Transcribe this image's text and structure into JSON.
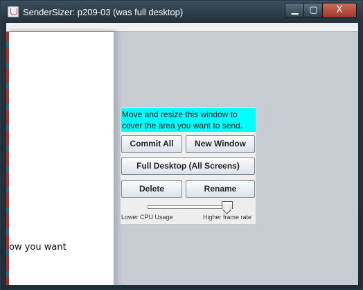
{
  "window": {
    "title": "SenderSizer: p209-03 (was full desktop)",
    "controls": {
      "minimize": "▁",
      "maximize": "▢",
      "close": "X"
    }
  },
  "desktop": {
    "partial_text": "ow you want"
  },
  "panel": {
    "info_text": "Move and resize this window to cover the area you want to send.",
    "info_color": "#00ffff",
    "buttons": {
      "commit_all": "Commit All",
      "new_window": "New Window",
      "full_desktop": "Full Desktop (All Screens)",
      "delete": "Delete",
      "rename": "Rename"
    },
    "slider": {
      "low_label": "Lower CPU Usage",
      "high_label": "Higher frame rate",
      "value_fraction": 0.95
    }
  }
}
